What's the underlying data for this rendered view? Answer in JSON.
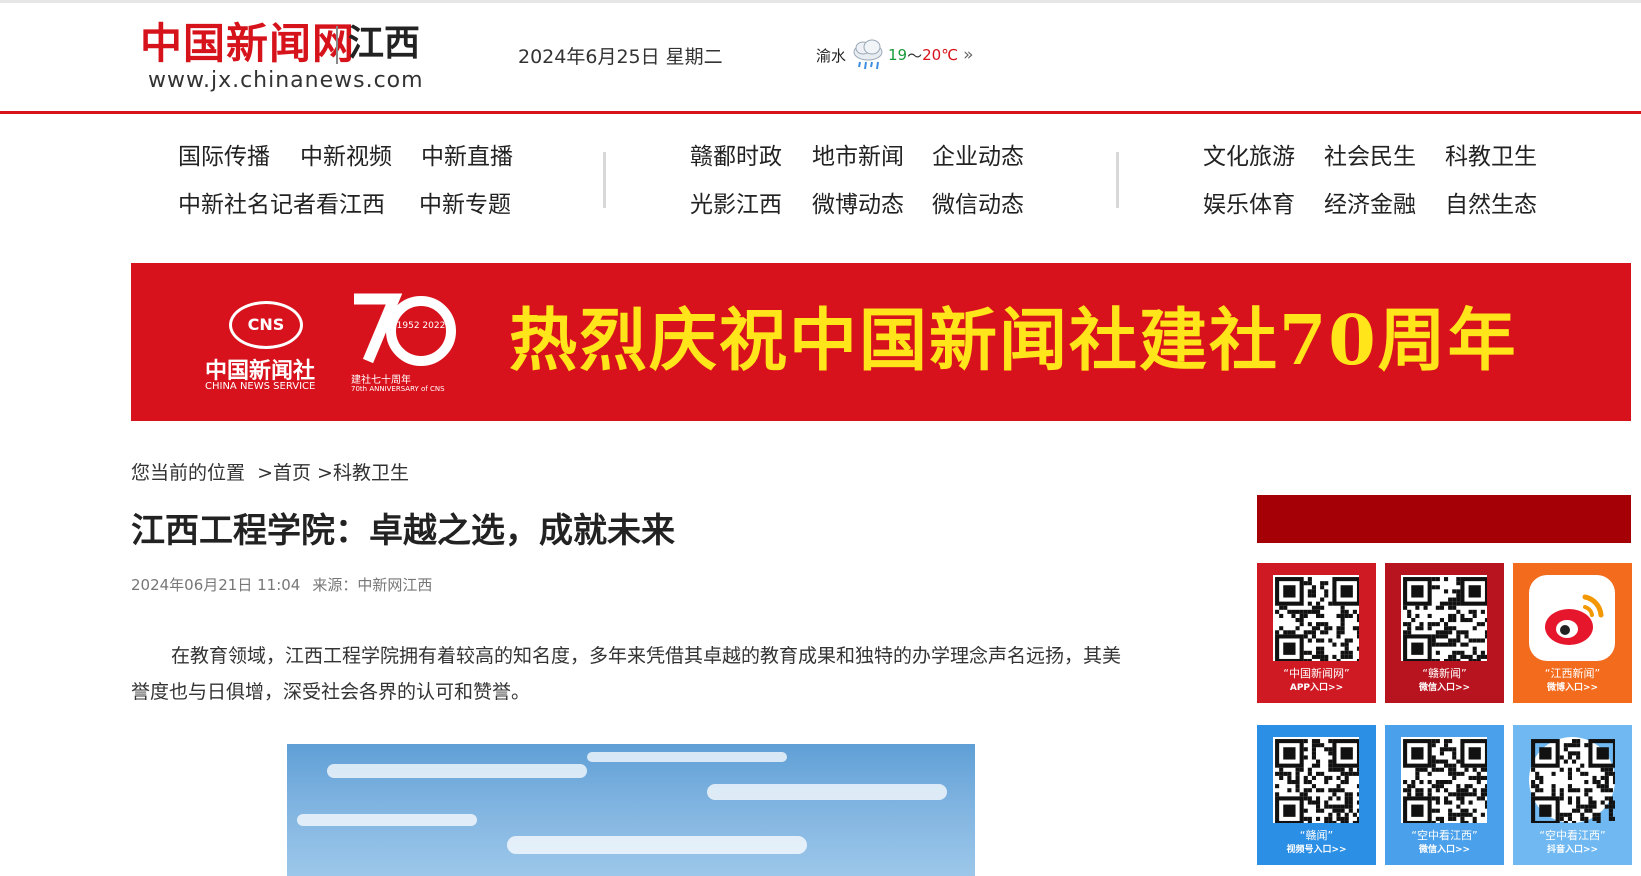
{
  "header": {
    "logo_cn": "中国新闻网",
    "logo_region": "江西",
    "logo_url": "www.jx.chinanews.com",
    "date": "2024年6月25日 星期二",
    "weather": {
      "city": "渝水",
      "icon": "rain-cloud-icon",
      "low": "19",
      "tilde": "～",
      "high": "20℃",
      "more": "»"
    }
  },
  "nav": {
    "group1": [
      "国际传播",
      "中新视频",
      "中新直播",
      "中新社名记者看江西",
      "中新专题"
    ],
    "group2": [
      "赣鄱时政",
      "地市新闻",
      "企业动态",
      "光影江西",
      "微博动态",
      "微信动态"
    ],
    "group3": [
      "文化旅游",
      "社会民生",
      "科教卫生",
      "娱乐体育",
      "经济金融",
      "自然生态"
    ]
  },
  "banner": {
    "cns": "CNS",
    "cns_name": "中国新闻社",
    "cns_en": "CHINA NEWS SERVICE",
    "years": "1952 2022",
    "anniv_cn": "建社七十周年",
    "anniv_en": "70th ANNIVERSARY of CNS",
    "title": "热烈庆祝中国新闻社建社70周年"
  },
  "breadcrumb": {
    "label": "您当前的位置",
    "sep": ">",
    "home": "首页",
    "section": "科教卫生"
  },
  "article": {
    "title": "江西工程学院：卓越之选，成就未来",
    "datetime": "2024年06月21日 11:04",
    "source": "来源：中新网江西",
    "paragraph": "在教育领域，江西工程学院拥有着较高的知名度，多年来凭借其卓越的教育成果和独特的办学理念声名远扬，其美誉度也与日俱增，深受社会各界的认可和赞誉。"
  },
  "sidebar": {
    "cards": [
      {
        "cap1": "“中国新闻网”",
        "cap2": "APP入口>>",
        "color": "#cf1a24"
      },
      {
        "cap1": "“赣新闻”",
        "cap2": "微信入口>>",
        "color": "#b8141f"
      },
      {
        "cap1": "“江西新闻”",
        "cap2": "微博入口>>",
        "color": "#f36b1c"
      },
      {
        "cap1": "“赣闻”",
        "cap2": "视频号入口>>",
        "color": "#2b8fe6"
      },
      {
        "cap1": "“空中看江西”",
        "cap2": "微信入口>>",
        "color": "#4aa0ea"
      },
      {
        "cap1": "“空中看江西”",
        "cap2": "抖音入口>>",
        "color": "#6fb8f2"
      }
    ]
  }
}
